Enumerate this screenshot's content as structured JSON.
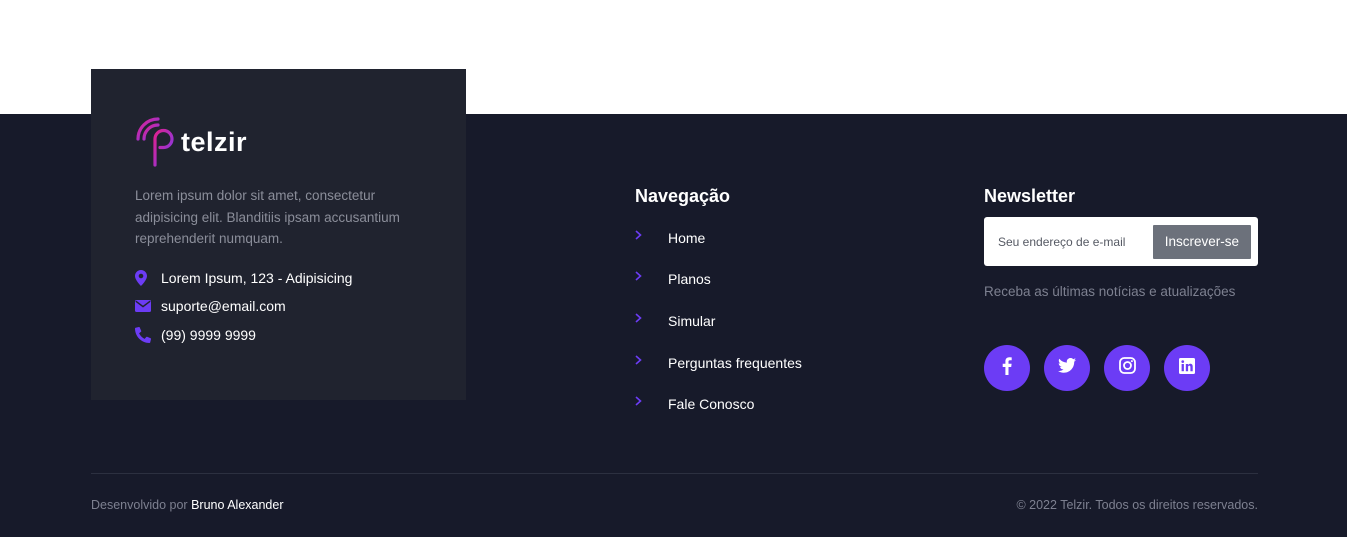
{
  "brand": {
    "name": "telzir",
    "description": "Lorem ipsum dolor sit amet, consectetur adipisicing elit. Blanditiis ipsam accusantium reprehenderit numquam.",
    "accent_color": "#6c3cf5"
  },
  "contact": [
    {
      "icon": "map-marker-icon",
      "text": "Lorem Ipsum, 123 - Adipisicing"
    },
    {
      "icon": "envelope-icon",
      "text": "suporte@email.com"
    },
    {
      "icon": "phone-icon",
      "text": "(99) 9999 9999"
    }
  ],
  "navigation": {
    "title": "Navegação",
    "items": [
      {
        "label": "Home"
      },
      {
        "label": "Planos"
      },
      {
        "label": "Simular"
      },
      {
        "label": "Perguntas frequentes"
      },
      {
        "label": "Fale Conosco"
      }
    ]
  },
  "newsletter": {
    "title": "Newsletter",
    "placeholder": "Seu endereço de e-mail",
    "button_label": "Inscrever-se",
    "hint": "Receba as últimas notícias e atualizações",
    "socials": [
      {
        "icon": "facebook-icon"
      },
      {
        "icon": "twitter-icon"
      },
      {
        "icon": "instagram-icon"
      },
      {
        "icon": "linkedin-icon"
      }
    ]
  },
  "bottom": {
    "credits_prefix": "Desenvolvido por",
    "credits_author": "Bruno Alexander",
    "copyright": "© 2022 Telzir. Todos os direitos reservados."
  }
}
